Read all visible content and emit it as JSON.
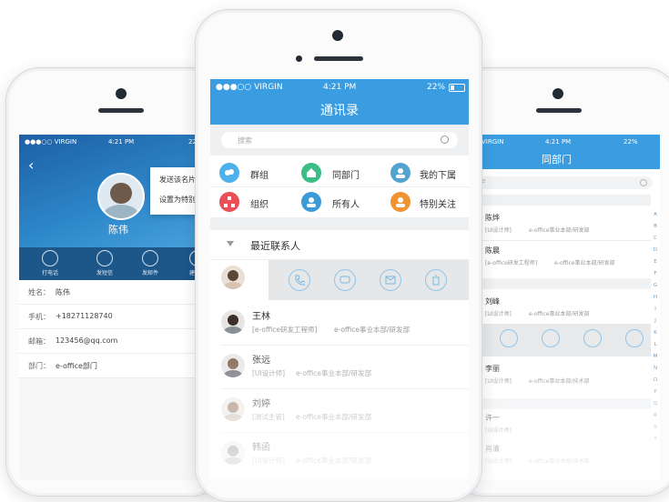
{
  "main": {
    "status": {
      "carrier": "●●●○○ VIRGIN",
      "time": "4:21 PM",
      "battery": "22%"
    },
    "title": "通讯录",
    "search_placeholder": "搜索",
    "menu": [
      {
        "label": "群组",
        "icon": "chat-bubbles-icon",
        "color": "#4fb1ec"
      },
      {
        "label": "同部门",
        "icon": "home-icon",
        "color": "#3dbd86"
      },
      {
        "label": "我的下属",
        "icon": "person-icon",
        "color": "#52a3cf"
      },
      {
        "label": "组织",
        "icon": "org-chart-icon",
        "color": "#ea4e56"
      },
      {
        "label": "所有人",
        "icon": "person-icon",
        "color": "#3a9bd8"
      },
      {
        "label": "特别关注",
        "icon": "person-icon",
        "color": "#f09333"
      }
    ],
    "recent_title": "最近联系人",
    "contacts": [
      {
        "name": "王林",
        "position": "[e-office研发工程师]",
        "dept": "e-office事业本部/研发部"
      },
      {
        "name": "张远",
        "position": "[UI设计师]",
        "dept": "e-office事业本部/研发部"
      },
      {
        "name": "刘婷",
        "position": "[测试主管]",
        "dept": "e-office事业本部/研发部"
      },
      {
        "name": "韩函",
        "position": "[UI设计师]",
        "dept": "e-office事业本部/研发部"
      }
    ]
  },
  "left": {
    "status": {
      "carrier": "●●●○○ VIRGIN",
      "time": "4:21 PM",
      "battery": "22"
    },
    "menu": [
      "发送该名片",
      "设置为特别关"
    ],
    "name": "陈伟",
    "actions": [
      "打电话",
      "发短信",
      "发邮件",
      "建日程"
    ],
    "fields": [
      {
        "label": "姓名：",
        "value": "陈伟"
      },
      {
        "label": "手机：",
        "value": "+18271128740"
      },
      {
        "label": "邮箱：",
        "value": "123456@qq.com"
      },
      {
        "label": "部门：",
        "value": "e-office部门"
      }
    ]
  },
  "right": {
    "status": {
      "carrier": "VIRGIN",
      "time": "4:21 PM",
      "battery": "22%"
    },
    "title": "同部门",
    "search_placeholder": "e",
    "contacts": [
      {
        "name": "陈烨",
        "position": "[UI设计师]",
        "dept": "e-office事业本部/研发部"
      },
      {
        "name": "陈晨",
        "position": "[e-office研发工程师]",
        "dept": "e-office事业本部/研发部"
      },
      {
        "name": "刘峰",
        "position": "[UI设计师]",
        "dept": "e-office事业本部/研发部"
      },
      {
        "name": "李丽",
        "position": "[UI设计师]",
        "dept": "e-office事业本部/技术部"
      },
      {
        "name": "许一",
        "position": "[UI设计师]",
        "dept": ""
      },
      {
        "name": "肖清",
        "position": "[UI设计师]",
        "dept": "e-office事业本部/技术部"
      }
    ],
    "index": [
      "A",
      "B",
      "C",
      "D",
      "E",
      "F",
      "G",
      "H",
      "I",
      "J",
      "K",
      "L",
      "M",
      "N",
      "O",
      "P",
      "Q",
      "R",
      "S",
      "T"
    ]
  },
  "colors": {
    "accent": "#3a9de2",
    "bar_dark": "#1c5a94"
  }
}
